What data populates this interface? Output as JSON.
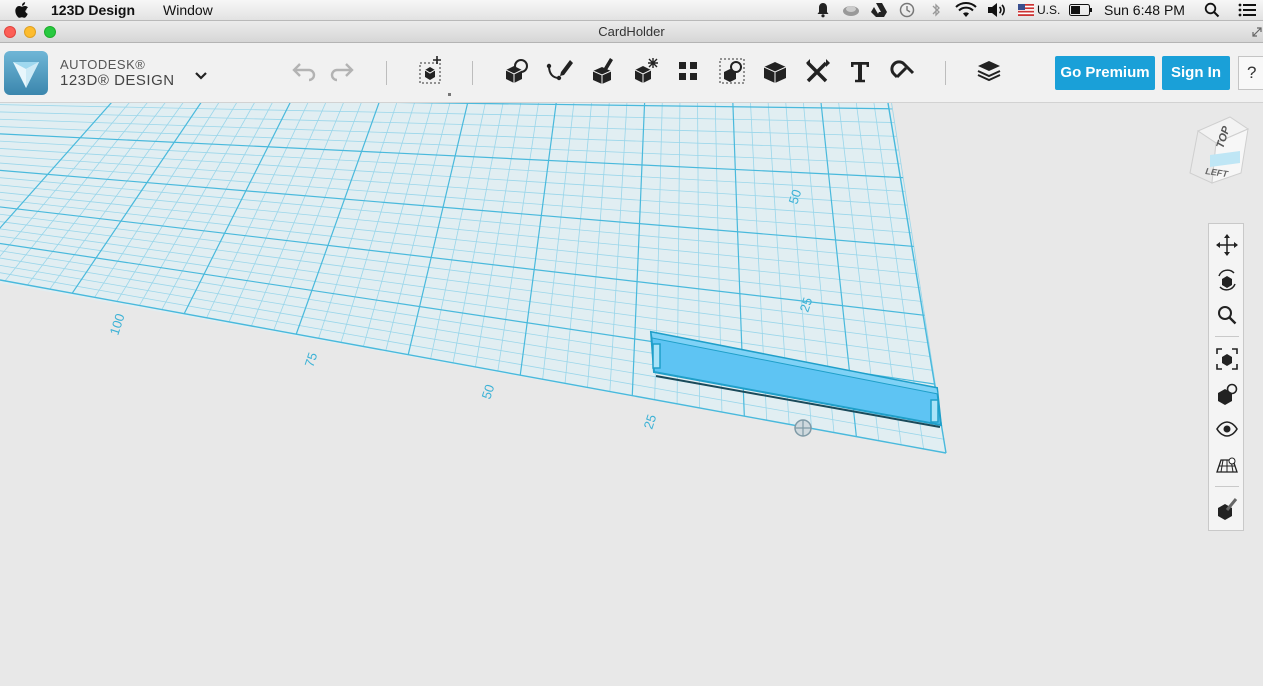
{
  "menubar": {
    "app_name": "123D Design",
    "menu_window": "Window",
    "input_source": "U.S.",
    "clock": "Sun 6:48 PM"
  },
  "window": {
    "title": "CardHolder"
  },
  "brand": {
    "line1": "AUTODESK®",
    "line2": "123D® DESIGN"
  },
  "toolbar": {
    "tools": [
      "undo",
      "redo",
      "transform",
      "primitives",
      "sketch",
      "construct",
      "modify",
      "pattern",
      "group",
      "combine",
      "measure",
      "text",
      "snap",
      "materials"
    ],
    "go_premium_label": "Go Premium",
    "sign_in_label": "Sign In",
    "help_label": "?"
  },
  "viewcube": {
    "top_label": "TOP",
    "left_label": "LEFT"
  },
  "grid": {
    "x_axis_labels": [
      "100",
      "75",
      "50",
      "25"
    ],
    "y_axis_labels": [
      "50",
      "25"
    ]
  },
  "colors": {
    "accent": "#1aa0d8",
    "grid_line": "#9ad6ea",
    "grid_major": "#49b9dc",
    "grid_fill": "#e1eef2",
    "object_fill": "#5ec4f3",
    "object_edge": "#1f9fc9"
  }
}
